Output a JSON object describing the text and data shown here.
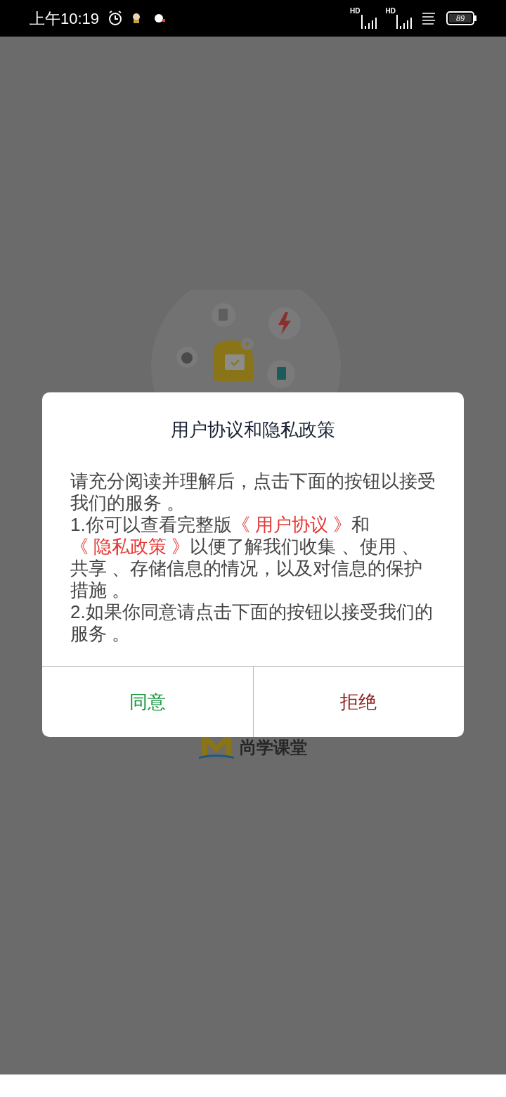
{
  "status_bar": {
    "time": "上午10:19",
    "signals": [
      {
        "label": "HD"
      },
      {
        "label": "HD"
      }
    ],
    "battery": "89"
  },
  "brand": {
    "name": "尚学课堂"
  },
  "dialog": {
    "title": "用户协议和隐私政策",
    "paragraphs": [
      [
        {
          "kind": "text",
          "text": "请充分阅读并理解后，点击下面的按钮以接受我们的服务 。"
        }
      ],
      [
        {
          "kind": "text",
          "text": "1.你可以查看完整版"
        },
        {
          "kind": "link",
          "text": "《 用户协议 》"
        },
        {
          "kind": "text",
          "text": "和"
        },
        {
          "kind": "link",
          "text": "《 隐私政策 》"
        },
        {
          "kind": "text",
          "text": "以便了解我们收集 、使用 、共享 、存储信息的情况，以及对信息的保护措施 。"
        }
      ],
      [
        {
          "kind": "text",
          "text": "2.如果你同意请点击下面的按钮以接受我们的服务 。"
        }
      ]
    ],
    "buttons": [
      {
        "kind": "accept",
        "label": "同意"
      },
      {
        "kind": "reject",
        "label": "拒绝"
      }
    ]
  }
}
